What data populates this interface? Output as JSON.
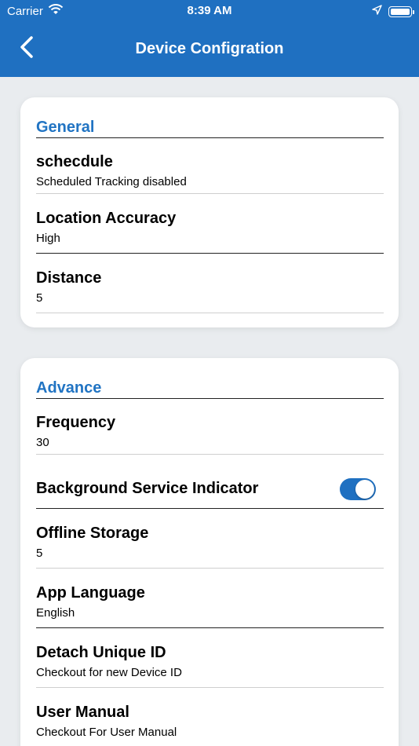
{
  "status_bar": {
    "carrier": "Carrier",
    "time": "8:39 AM",
    "icons": [
      "wifi-icon",
      "location-arrow-icon",
      "battery-icon"
    ]
  },
  "nav": {
    "title": "Device Configration",
    "back_icon": "chevron-left-icon"
  },
  "colors": {
    "header_bg": "#1f70c1",
    "section_title": "#2174c3",
    "page_bg": "#e9ecef",
    "toggle_on": "#1f70c1"
  },
  "general": {
    "title": "General",
    "items": [
      {
        "label": "schecdule",
        "value": "Scheduled Tracking disabled"
      },
      {
        "label": "Location Accuracy",
        "value": "High"
      },
      {
        "label": "Distance",
        "value": "5"
      }
    ]
  },
  "advance": {
    "title": "Advance",
    "frequency": {
      "label": "Frequency",
      "value": "30"
    },
    "background_service": {
      "label": "Background Service Indicator",
      "enabled": true
    },
    "offline_storage": {
      "label": "Offline Storage",
      "value": "5"
    },
    "app_language": {
      "label": "App Language",
      "value": "English"
    },
    "detach_id": {
      "label": "Detach Unique ID",
      "value": "Checkout for new Device ID"
    },
    "user_manual": {
      "label": "User Manual",
      "value": "Checkout For User Manual"
    }
  }
}
